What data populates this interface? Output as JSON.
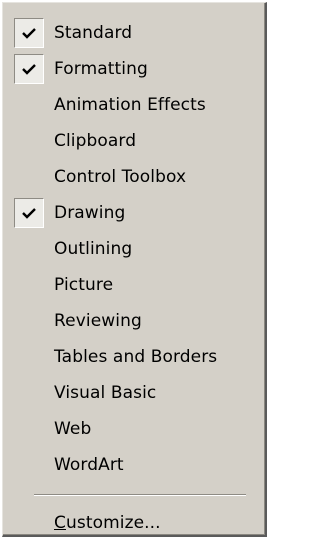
{
  "menu": {
    "items": [
      {
        "label": "Standard",
        "checked": true
      },
      {
        "label": "Formatting",
        "checked": true
      },
      {
        "label": "Animation Effects",
        "checked": false
      },
      {
        "label": "Clipboard",
        "checked": false
      },
      {
        "label": "Control Toolbox",
        "checked": false
      },
      {
        "label": "Drawing",
        "checked": true
      },
      {
        "label": "Outlining",
        "checked": false
      },
      {
        "label": "Picture",
        "checked": false
      },
      {
        "label": "Reviewing",
        "checked": false
      },
      {
        "label": "Tables and Borders",
        "checked": false
      },
      {
        "label": "Visual Basic",
        "checked": false
      },
      {
        "label": "Web",
        "checked": false
      },
      {
        "label": "WordArt",
        "checked": false
      }
    ],
    "customize": {
      "accel": "C",
      "rest": "ustomize..."
    }
  },
  "icons": {
    "check": "check-icon"
  },
  "colors": {
    "menu_bg": "#d4d0c8",
    "check_bg": "#ecebe7",
    "text": "#000000"
  }
}
